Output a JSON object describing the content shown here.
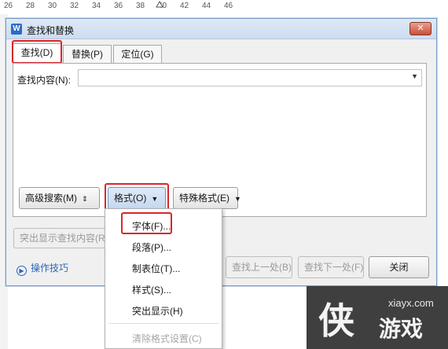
{
  "ruler": {
    "numbers": [
      "26",
      "28",
      "30",
      "32",
      "34",
      "36",
      "38",
      "40",
      "42",
      "44",
      "46"
    ]
  },
  "dialog": {
    "app_icon": "W",
    "title": "查找和替换",
    "close": "✕",
    "tabs": [
      {
        "label": "查找(D)",
        "active": true
      },
      {
        "label": "替换(P)",
        "active": false
      },
      {
        "label": "定位(G)",
        "active": false
      }
    ],
    "find_label": "查找内容(N):",
    "find_value": "",
    "buttons": {
      "advanced": "高级搜索(M)",
      "format": "格式(O)",
      "special": "特殊格式(E)",
      "highlight": "突出显示查找内容(R)",
      "find_prev": "查找上一处(B)",
      "find_next": "查找下一处(F)",
      "close": "关闭"
    },
    "tips": "操作技巧"
  },
  "format_menu": {
    "items": [
      {
        "label": "字体(F)...",
        "enabled": true
      },
      {
        "label": "段落(P)...",
        "enabled": true
      },
      {
        "label": "制表位(T)...",
        "enabled": true
      },
      {
        "label": "样式(S)...",
        "enabled": true
      },
      {
        "label": "突出显示(H)",
        "enabled": true
      },
      {
        "label": "清除格式设置(C)",
        "enabled": false
      }
    ]
  },
  "watermark": {
    "logo": "侠",
    "site": "xiayx.com",
    "name": "游戏"
  },
  "colors": {
    "highlight_red": "#d8262c",
    "title_bar": "#dfe9f6",
    "link_blue": "#2a64b8"
  }
}
